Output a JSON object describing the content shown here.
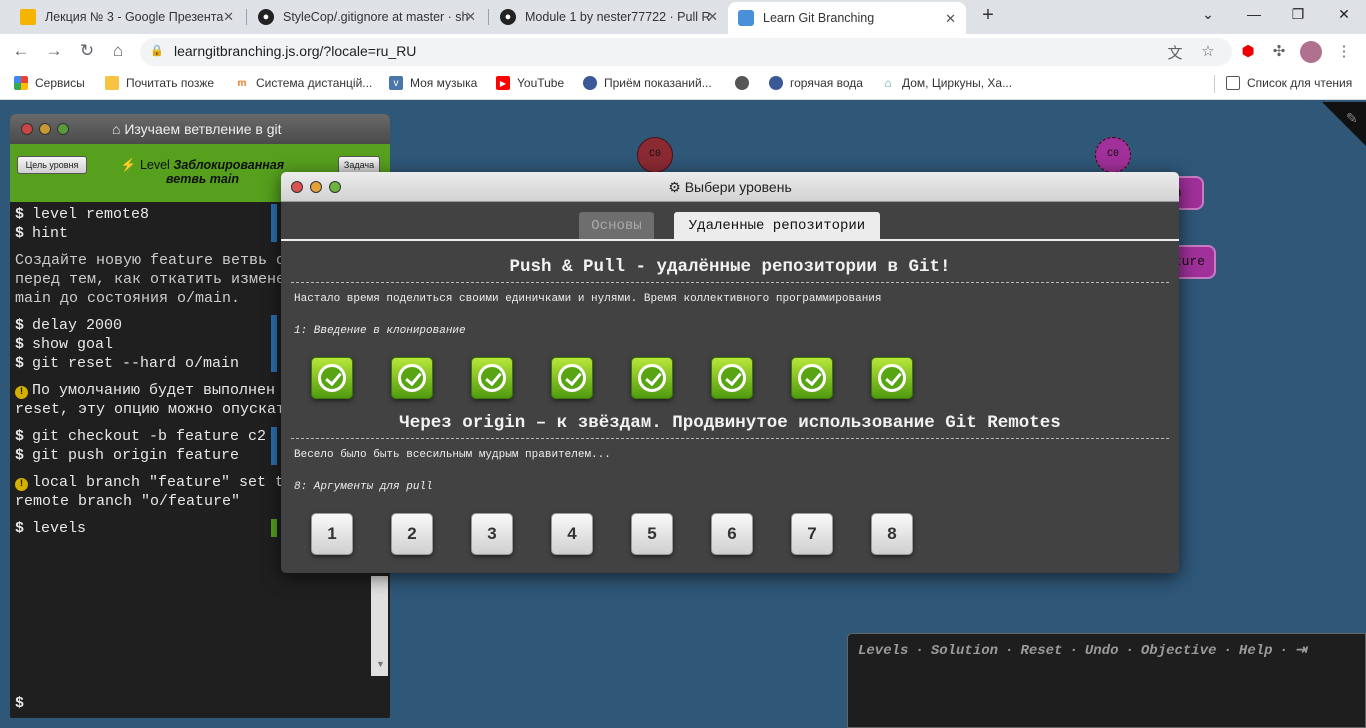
{
  "browser": {
    "tabs": [
      {
        "title": "Лекция № 3 - Google Презента",
        "icon": "slides-icon",
        "color": "#f4b400"
      },
      {
        "title": "StyleCop/.gitignore at master · sh",
        "icon": "github-icon",
        "color": "#222222"
      },
      {
        "title": "Module 1 by nester77722 · Pull R",
        "icon": "github-icon",
        "color": "#222222"
      },
      {
        "title": "Learn Git Branching",
        "icon": "git-branching-icon",
        "color": "#4a90d9"
      }
    ],
    "new_tab": "+",
    "url": "learngitbranching.js.org/?locale=ru_RU",
    "bookmarks": [
      {
        "label": "Сервисы",
        "icon": "apps-grid-icon"
      },
      {
        "label": "Почитать позже",
        "icon": "folder-icon"
      },
      {
        "label": "Система дистанцій...",
        "icon": "moodle-icon"
      },
      {
        "label": "Моя музыка",
        "icon": "vk-icon"
      },
      {
        "label": "YouTube",
        "icon": "youtube-icon"
      },
      {
        "label": "Приём показаний...",
        "icon": "globe-badge-icon"
      },
      {
        "label": "",
        "icon": "globe-icon"
      },
      {
        "label": "горячая вода",
        "icon": "globe-badge-icon"
      },
      {
        "label": "Дом, Циркуны, Ха...",
        "icon": "house-icon"
      }
    ],
    "reading_list": "Список для чтения"
  },
  "terminal": {
    "title": "Изучаем ветвление в git",
    "goal_button": "Цель уровня",
    "task_button": "Задача",
    "level_prefix": "Level",
    "level_name": "Заблокированная ветвь main",
    "lines": [
      {
        "prompt": "$",
        "text": "level remote8"
      },
      {
        "prompt": "$",
        "text": "hint"
      },
      {
        "prompt": "",
        "text": "Создайте новую feature ветвь о"
      },
      {
        "prompt": "",
        "text": "перед тем, как откатить измене"
      },
      {
        "prompt": "",
        "text": "main до состояния o/main."
      },
      {
        "prompt": "$",
        "text": "delay 2000"
      },
      {
        "prompt": "$",
        "text": "show goal"
      },
      {
        "prompt": "$",
        "text": "git reset --hard o/main"
      },
      {
        "prompt": "!",
        "text": "По умолчанию будет выполнен"
      },
      {
        "prompt": "",
        "text": "reset, эту опцию можно опускат"
      },
      {
        "prompt": "$",
        "text": "git checkout -b feature c2"
      },
      {
        "prompt": "$",
        "text": "git push origin feature"
      },
      {
        "prompt": "!",
        "text": "local branch \"feature\" set t"
      },
      {
        "prompt": "",
        "text": "remote branch \"o/feature\""
      },
      {
        "prompt": "$",
        "text": "levels"
      }
    ],
    "input_prompt": "$"
  },
  "visualization": {
    "nodes": [
      "C0",
      "C0"
    ],
    "labels": [
      "in",
      "ature"
    ]
  },
  "modal": {
    "title": "Выбери уровень",
    "tabs": [
      {
        "label": "Основы",
        "active": false
      },
      {
        "label": "Удаленные репозитории",
        "active": true
      }
    ],
    "sections": [
      {
        "title": "Push & Pull - удалённые репозитории в Git!",
        "description": "Настало время поделиться своими единичками и нулями. Время коллективного программирования",
        "current": "1: Введение в клонирование",
        "levels": [
          {
            "label": "1",
            "done": true
          },
          {
            "label": "2",
            "done": true
          },
          {
            "label": "3",
            "done": true
          },
          {
            "label": "4",
            "done": true
          },
          {
            "label": "5",
            "done": true
          },
          {
            "label": "6",
            "done": true
          },
          {
            "label": "7",
            "done": true
          },
          {
            "label": "8",
            "done": true
          }
        ]
      },
      {
        "title": "Через origin – к звёздам. Продвинутое использование Git Remotes",
        "description": "Весело было быть всесильным мудрым правителем...",
        "current": "8: Аргументы для pull",
        "levels": [
          {
            "label": "1",
            "done": false
          },
          {
            "label": "2",
            "done": false
          },
          {
            "label": "3",
            "done": false
          },
          {
            "label": "4",
            "done": false
          },
          {
            "label": "5",
            "done": false
          },
          {
            "label": "6",
            "done": false
          },
          {
            "label": "7",
            "done": false
          },
          {
            "label": "8",
            "done": false
          }
        ]
      }
    ]
  },
  "commandbar": {
    "links": [
      "Levels",
      "Solution",
      "Reset",
      "Undo",
      "Objective",
      "Help"
    ],
    "separator": "·"
  },
  "colors": {
    "background": "#2f5778",
    "level_bar": "#56a01e",
    "node_red": "#8b2a32",
    "node_purple": "#a0309a"
  }
}
